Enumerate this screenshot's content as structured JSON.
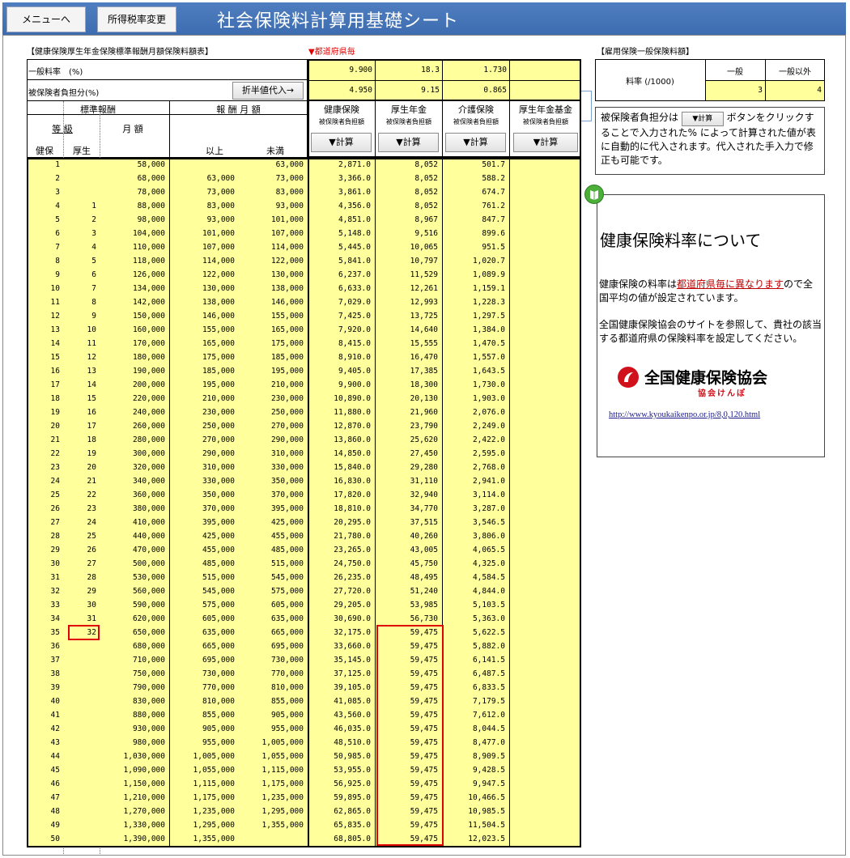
{
  "header": {
    "menu_button": "メニューへ",
    "tax_button": "所得税率変更",
    "title": "社会保険料計算用基礎シート"
  },
  "table": {
    "caption": "【健康保険厚生年金保険標準報酬月額保険料額表】",
    "prefecture_note": "▼都道府県毎",
    "rate_label": "一般料率　(%)",
    "burden_label": "被保険者負担分(%)",
    "half_button": "折半値代入→",
    "rates": {
      "health": "9.900",
      "pension": "18.3",
      "care": "1.730",
      "fund": ""
    },
    "burden": {
      "health": "4.950",
      "pension": "9.15",
      "care": "0.865",
      "fund": ""
    },
    "headers": {
      "standard": "標準報酬",
      "remuneration": "報 酬 月 額",
      "grade": "等 級",
      "monthly": "月 額",
      "kenpo": "健保",
      "kosei": "厚生",
      "from": "以上",
      "to": "未満",
      "health": "健康保険",
      "pension": "厚生年金",
      "care": "介護保険",
      "fund": "厚生年金基金",
      "sub": "被保険者負担額",
      "calc": "▼計算"
    },
    "rows": [
      [
        "1",
        "",
        "58,000",
        "",
        "63,000",
        "2,871.0",
        "8,052",
        "501.7"
      ],
      [
        "2",
        "",
        "68,000",
        "63,000",
        "73,000",
        "3,366.0",
        "8,052",
        "588.2"
      ],
      [
        "3",
        "",
        "78,000",
        "73,000",
        "83,000",
        "3,861.0",
        "8,052",
        "674.7"
      ],
      [
        "4",
        "1",
        "88,000",
        "83,000",
        "93,000",
        "4,356.0",
        "8,052",
        "761.2"
      ],
      [
        "5",
        "2",
        "98,000",
        "93,000",
        "101,000",
        "4,851.0",
        "8,967",
        "847.7"
      ],
      [
        "6",
        "3",
        "104,000",
        "101,000",
        "107,000",
        "5,148.0",
        "9,516",
        "899.6"
      ],
      [
        "7",
        "4",
        "110,000",
        "107,000",
        "114,000",
        "5,445.0",
        "10,065",
        "951.5"
      ],
      [
        "8",
        "5",
        "118,000",
        "114,000",
        "122,000",
        "5,841.0",
        "10,797",
        "1,020.7"
      ],
      [
        "9",
        "6",
        "126,000",
        "122,000",
        "130,000",
        "6,237.0",
        "11,529",
        "1,089.9"
      ],
      [
        "10",
        "7",
        "134,000",
        "130,000",
        "138,000",
        "6,633.0",
        "12,261",
        "1,159.1"
      ],
      [
        "11",
        "8",
        "142,000",
        "138,000",
        "146,000",
        "7,029.0",
        "12,993",
        "1,228.3"
      ],
      [
        "12",
        "9",
        "150,000",
        "146,000",
        "155,000",
        "7,425.0",
        "13,725",
        "1,297.5"
      ],
      [
        "13",
        "10",
        "160,000",
        "155,000",
        "165,000",
        "7,920.0",
        "14,640",
        "1,384.0"
      ],
      [
        "14",
        "11",
        "170,000",
        "165,000",
        "175,000",
        "8,415.0",
        "15,555",
        "1,470.5"
      ],
      [
        "15",
        "12",
        "180,000",
        "175,000",
        "185,000",
        "8,910.0",
        "16,470",
        "1,557.0"
      ],
      [
        "16",
        "13",
        "190,000",
        "185,000",
        "195,000",
        "9,405.0",
        "17,385",
        "1,643.5"
      ],
      [
        "17",
        "14",
        "200,000",
        "195,000",
        "210,000",
        "9,900.0",
        "18,300",
        "1,730.0"
      ],
      [
        "18",
        "15",
        "220,000",
        "210,000",
        "230,000",
        "10,890.0",
        "20,130",
        "1,903.0"
      ],
      [
        "19",
        "16",
        "240,000",
        "230,000",
        "250,000",
        "11,880.0",
        "21,960",
        "2,076.0"
      ],
      [
        "20",
        "17",
        "260,000",
        "250,000",
        "270,000",
        "12,870.0",
        "23,790",
        "2,249.0"
      ],
      [
        "21",
        "18",
        "280,000",
        "270,000",
        "290,000",
        "13,860.0",
        "25,620",
        "2,422.0"
      ],
      [
        "22",
        "19",
        "300,000",
        "290,000",
        "310,000",
        "14,850.0",
        "27,450",
        "2,595.0"
      ],
      [
        "23",
        "20",
        "320,000",
        "310,000",
        "330,000",
        "15,840.0",
        "29,280",
        "2,768.0"
      ],
      [
        "24",
        "21",
        "340,000",
        "330,000",
        "350,000",
        "16,830.0",
        "31,110",
        "2,941.0"
      ],
      [
        "25",
        "22",
        "360,000",
        "350,000",
        "370,000",
        "17,820.0",
        "32,940",
        "3,114.0"
      ],
      [
        "26",
        "23",
        "380,000",
        "370,000",
        "395,000",
        "18,810.0",
        "34,770",
        "3,287.0"
      ],
      [
        "27",
        "24",
        "410,000",
        "395,000",
        "425,000",
        "20,295.0",
        "37,515",
        "3,546.5"
      ],
      [
        "28",
        "25",
        "440,000",
        "425,000",
        "455,000",
        "21,780.0",
        "40,260",
        "3,806.0"
      ],
      [
        "29",
        "26",
        "470,000",
        "455,000",
        "485,000",
        "23,265.0",
        "43,005",
        "4,065.5"
      ],
      [
        "30",
        "27",
        "500,000",
        "485,000",
        "515,000",
        "24,750.0",
        "45,750",
        "4,325.0"
      ],
      [
        "31",
        "28",
        "530,000",
        "515,000",
        "545,000",
        "26,235.0",
        "48,495",
        "4,584.5"
      ],
      [
        "32",
        "29",
        "560,000",
        "545,000",
        "575,000",
        "27,720.0",
        "51,240",
        "4,844.0"
      ],
      [
        "33",
        "30",
        "590,000",
        "575,000",
        "605,000",
        "29,205.0",
        "53,985",
        "5,103.5"
      ],
      [
        "34",
        "31",
        "620,000",
        "605,000",
        "635,000",
        "30,690.0",
        "56,730",
        "5,363.0"
      ],
      [
        "35",
        "32",
        "650,000",
        "635,000",
        "665,000",
        "32,175.0",
        "59,475",
        "5,622.5"
      ],
      [
        "36",
        "",
        "680,000",
        "665,000",
        "695,000",
        "33,660.0",
        "59,475",
        "5,882.0"
      ],
      [
        "37",
        "",
        "710,000",
        "695,000",
        "730,000",
        "35,145.0",
        "59,475",
        "6,141.5"
      ],
      [
        "38",
        "",
        "750,000",
        "730,000",
        "770,000",
        "37,125.0",
        "59,475",
        "6,487.5"
      ],
      [
        "39",
        "",
        "790,000",
        "770,000",
        "810,000",
        "39,105.0",
        "59,475",
        "6,833.5"
      ],
      [
        "40",
        "",
        "830,000",
        "810,000",
        "855,000",
        "41,085.0",
        "59,475",
        "7,179.5"
      ],
      [
        "41",
        "",
        "880,000",
        "855,000",
        "905,000",
        "43,560.0",
        "59,475",
        "7,612.0"
      ],
      [
        "42",
        "",
        "930,000",
        "905,000",
        "955,000",
        "46,035.0",
        "59,475",
        "8,044.5"
      ],
      [
        "43",
        "",
        "980,000",
        "955,000",
        "1,005,000",
        "48,510.0",
        "59,475",
        "8,477.0"
      ],
      [
        "44",
        "",
        "1,030,000",
        "1,005,000",
        "1,055,000",
        "50,985.0",
        "59,475",
        "8,909.5"
      ],
      [
        "45",
        "",
        "1,090,000",
        "1,055,000",
        "1,115,000",
        "53,955.0",
        "59,475",
        "9,428.5"
      ],
      [
        "46",
        "",
        "1,150,000",
        "1,115,000",
        "1,175,000",
        "56,925.0",
        "59,475",
        "9,947.5"
      ],
      [
        "47",
        "",
        "1,210,000",
        "1,175,000",
        "1,235,000",
        "59,895.0",
        "59,475",
        "10,466.5"
      ],
      [
        "48",
        "",
        "1,270,000",
        "1,235,000",
        "1,295,000",
        "62,865.0",
        "59,475",
        "10,985.5"
      ],
      [
        "49",
        "",
        "1,330,000",
        "1,295,000",
        "1,355,000",
        "65,835.0",
        "59,475",
        "11,504.5"
      ],
      [
        "50",
        "",
        "1,390,000",
        "1,355,000",
        "",
        "68,805.0",
        "59,475",
        "12,023.5"
      ]
    ]
  },
  "employment": {
    "caption": "【雇用保険一般保険料額】",
    "rate_label": "料率 (/1000)",
    "col_general": "一般",
    "col_other": "一般以外",
    "val_general": "3",
    "val_other": "4"
  },
  "note": {
    "prefix": "被保険者負担分は",
    "button": "▼計算",
    "text": "ボタンをクリックすることで入力された% によって計算された値が表に自動的に代入されます。代入された手入力で修正も可能です。"
  },
  "info": {
    "heading": "健康保険料率について",
    "p1_pre": "健康保険の料率は",
    "p1_link": "都道府県毎に異なります",
    "p1_post": "ので全国平均の値が設定されています。",
    "p2": "全国健康保険協会のサイトを参照して、貴社の該当する都道府県の保険料率を設定してください。",
    "logo_name": "全国健康保険協会",
    "logo_sub": "協会けんぽ",
    "url": "http://www.kyoukaikenpo.or.jp/8,0,120.html"
  }
}
